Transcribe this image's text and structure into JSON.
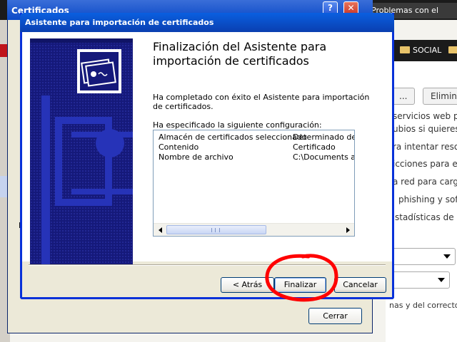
{
  "background_browser": {
    "tab_title": "Problemas con el",
    "bookmark_folder": "SOCIAL",
    "buttons": [
      "...",
      "Elimin"
    ],
    "content_lines": [
      "servicios web p",
      "ubios si quieres.",
      "ra intentar reso",
      "icciones para e",
      "a red para carg",
      "phishing y sof",
      "stadísticas de"
    ],
    "bottom_line": "nas y del corrector or"
  },
  "outer_window": {
    "title": "Certificados",
    "help_glyph": "?",
    "close_glyph": "✕",
    "tab_fragment": "P",
    "close_button": "Cerrar"
  },
  "wizard": {
    "title": "Asistente para importación de certificados",
    "heading": "Finalización del Asistente para importación de certificados",
    "completed_text": "Ha completado con éxito el Asistente para importación de certificados.",
    "config_label": "Ha especificado la siguiente configuración:",
    "config_rows": [
      {
        "key": "Almacén de certificados seleccionado",
        "value": "Determinado de fo"
      },
      {
        "key": "Contenido",
        "value": "Certificado"
      },
      {
        "key": "Nombre de archivo",
        "value": "C:\\Documents and"
      }
    ],
    "buttons": {
      "back": "< Atrás",
      "finish": "Finalizar",
      "cancel": "Cancelar"
    }
  },
  "annotation_color": "#ff0000"
}
